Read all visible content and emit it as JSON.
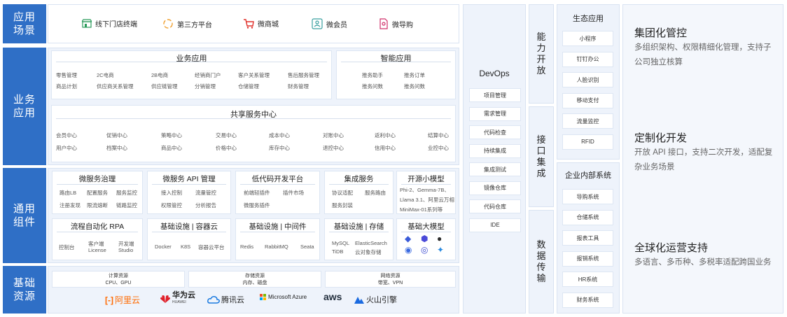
{
  "row_labels": {
    "scenario": "应用场景",
    "business": "业务应用",
    "common": "通用组件",
    "infra": "基础资源"
  },
  "scenarios": [
    {
      "label": "线下门店终端",
      "icon": "store-icon"
    },
    {
      "label": "第三方平台",
      "icon": "platform-icon"
    },
    {
      "label": "微商城",
      "icon": "cart-icon"
    },
    {
      "label": "微会员",
      "icon": "member-card-icon"
    },
    {
      "label": "微导购",
      "icon": "guide-doc-icon"
    }
  ],
  "biz_app": {
    "title": "业务应用",
    "items": [
      "零售管理",
      "2C电商",
      "2B电商",
      "经销商门户",
      "客户关系管理",
      "售后服务管理",
      "商品计划",
      "供应商关系管理",
      "供应链管理",
      "分销管理",
      "仓储管理",
      "财务管理"
    ]
  },
  "smart_app": {
    "title": "智能应用",
    "items": [
      "推务助手",
      "推务订单",
      "推务问数",
      "推务问数"
    ]
  },
  "shared": {
    "title": "共享服务中心",
    "items": [
      "会员中心",
      "促销中心",
      "策略中心",
      "交易中心",
      "成本中心",
      "对账中心",
      "返利中心",
      "结算中心",
      "用户中心",
      "档案中心",
      "商品中心",
      "价格中心",
      "库存中心",
      "退控中心",
      "信用中心",
      "业控中心"
    ]
  },
  "common": {
    "ms_gov": {
      "title": "微服务治理",
      "items": [
        "路由LB",
        "配置服务",
        "服务监控",
        "注册发现",
        "限流熔断",
        "链路监控"
      ]
    },
    "ms_api": {
      "title": "微服务 API 管理",
      "items": [
        "接入控制",
        "流量管控",
        "权限管控",
        "分析报告"
      ]
    },
    "lowcode": {
      "title": "低代码开发平台",
      "items": [
        "前端轻插件",
        "插件市场",
        "微服务插件"
      ]
    },
    "integ": {
      "title": "集成服务",
      "items": [
        "协议适配",
        "服务路由",
        "服务封装"
      ]
    },
    "osmodel": {
      "title": "开源小模型",
      "items": [
        "Phi-2、Gemma-7B、",
        "Llama 3.1、阿里云万相",
        "MiniMax-01系列等"
      ]
    },
    "rpa": {
      "title": "流程自动化 RPA",
      "items": [
        "控制台",
        "客户端",
        "License",
        "开发端",
        "Studio"
      ]
    },
    "infra_cloud": {
      "title": "基础设施 | 容器云",
      "items": [
        "Docker",
        "K8S",
        "容器云平台"
      ]
    },
    "infra_mw": {
      "title": "基础设施 | 中间件",
      "items": [
        "Redis",
        "RabbitMQ",
        "Seata"
      ]
    },
    "infra_st": {
      "title": "基础设施 | 存储",
      "items": [
        "MySQL",
        "ElasticSearch",
        "TiDB",
        "云对象存储"
      ]
    },
    "bigmodel": {
      "title": "基础大模型"
    }
  },
  "resources": [
    {
      "title": "计算资源",
      "sub": "CPU、GPU"
    },
    {
      "title": "存储资源",
      "sub": "内存、磁盘"
    },
    {
      "title": "网络资源",
      "sub": "带宽、VPN"
    }
  ],
  "clouds": [
    "阿里云",
    "华为云",
    "腾讯云",
    "Microsoft Azure",
    "aws",
    "火山引擎"
  ],
  "huawei_sub": "HUAWEI",
  "devops": {
    "title": "DevOps",
    "items": [
      "项目管理",
      "需求管理",
      "代码检查",
      "持续集成",
      "集成测试",
      "镜像仓库",
      "代码仓库",
      "IDE"
    ]
  },
  "vertical": {
    "open": "能力开放",
    "iface": "接口集成",
    "data": "数据传输"
  },
  "eco": {
    "title": "生态应用",
    "items": [
      "小程序",
      "钉钉办公",
      "人脸识别",
      "移动支付",
      "流量监控",
      "RFID"
    ]
  },
  "internal": {
    "title": "企业内部系统",
    "items": [
      "导购系统",
      "仓储系统",
      "报表工具",
      "报销系统",
      "HR系统",
      "财务系统"
    ]
  },
  "features": [
    {
      "title": "集团化管控",
      "desc": "多组织架构、权限精细化管理，支持子公司独立核算"
    },
    {
      "title": "定制化开发",
      "desc": "开放 API 接口，支持二次开发，适配复杂业务场景"
    },
    {
      "title": "全球化运营支持",
      "desc": "多语言、多币种、多税率适配跨国业务"
    }
  ],
  "colors": {
    "brand": "#2f6fc6",
    "panel": "#eef3fb",
    "border": "#dde6f3"
  }
}
